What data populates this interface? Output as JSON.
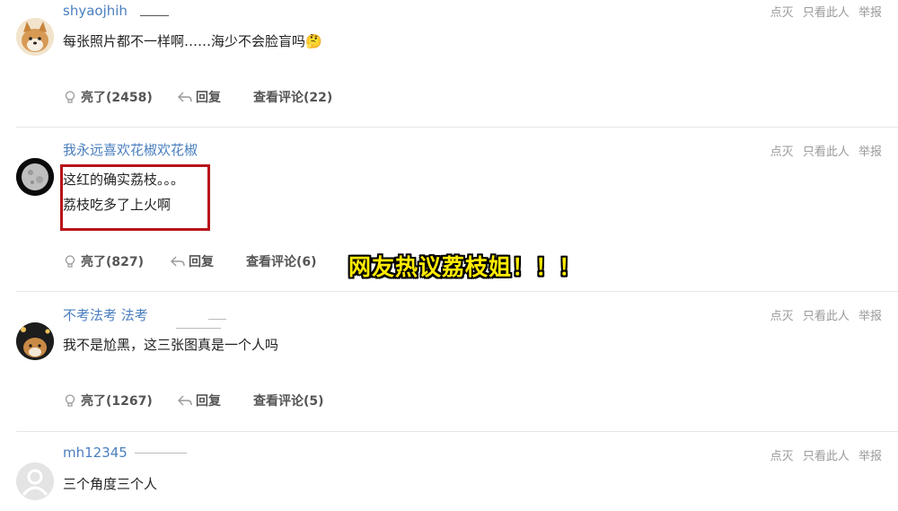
{
  "comments": [
    {
      "username": "shyaojhih",
      "content_lines": [
        "每张照片都不一样啊……海少不会脸盲吗🤔"
      ],
      "likes": "亮了(2458)",
      "reply": "回复",
      "view_replies": "查看评论(22)",
      "actions": [
        "点灭",
        "只看此人",
        "举报"
      ]
    },
    {
      "username": "我永远喜欢花椒欢花椒",
      "content_lines": [
        "这红的确实荔枝。。。",
        "荔枝吃多了上火啊"
      ],
      "likes": "亮了(827)",
      "reply": "回复",
      "view_replies": "查看评论(6)",
      "actions": [
        "点灭",
        "只看此人",
        "举报"
      ]
    },
    {
      "username": "不考法考 法考",
      "content_lines": [
        "我不是尬黑，这三张图真是一个人吗"
      ],
      "likes": "亮了(1267)",
      "reply": "回复",
      "view_replies": "查看评论(5)",
      "actions": [
        "点灭",
        "只看此人",
        "举报"
      ]
    },
    {
      "username": "mh12345",
      "content_lines": [
        "三个角度三个人"
      ],
      "actions": [
        "点灭",
        "只看此人",
        "举报"
      ]
    }
  ],
  "overlay_caption": "网友热议荔枝姐！！！",
  "colors": {
    "username": "#4a7fbf",
    "highlight_box": "#b8141a",
    "caption": "#ffeb00"
  }
}
